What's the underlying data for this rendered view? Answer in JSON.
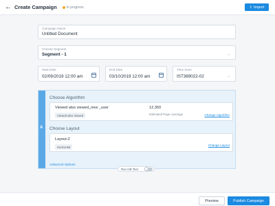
{
  "header": {
    "back_icon": "arrow-left-icon",
    "title": "Create Campaign",
    "status": "In progress",
    "status_color": "#f5a623",
    "import_label": "Import",
    "import_icon": "upload-icon",
    "accent": "#1b8ae0"
  },
  "form": {
    "campaign_name": {
      "label": "Campaign Name",
      "value": "Untitled Document"
    },
    "segment": {
      "label": "Choose Segment",
      "value": "Segment - 1"
    },
    "start_date": {
      "label": "Start Date",
      "value": "02/09/2019 12:00 am"
    },
    "end_date": {
      "label": "End Date",
      "value": "03/10/2019 12:00 am"
    },
    "time_zone": {
      "label": "Time Zone",
      "value": "IST389022-02"
    }
  },
  "algorithm_panel": {
    "variant_letter": "A",
    "algorithm_heading": "Choose Algorithm",
    "algorithm": {
      "name": "Viewed also viewed_new _user",
      "tag": "Viewed also Viewed",
      "count": "12,350",
      "count_label": "Estimated Page coverage",
      "change_link": "Change Algorithm"
    },
    "layout_heading": "Choose Layout",
    "layout": {
      "name": "Layout-2",
      "tag": "Horizontal",
      "change_link": "Change Layout"
    },
    "advanced_link": "Advanced Options"
  },
  "ab_test": {
    "label": "Run A/B Test",
    "enabled": false
  },
  "footer": {
    "preview_label": "Preview",
    "publish_label": "Publish Campaign"
  }
}
